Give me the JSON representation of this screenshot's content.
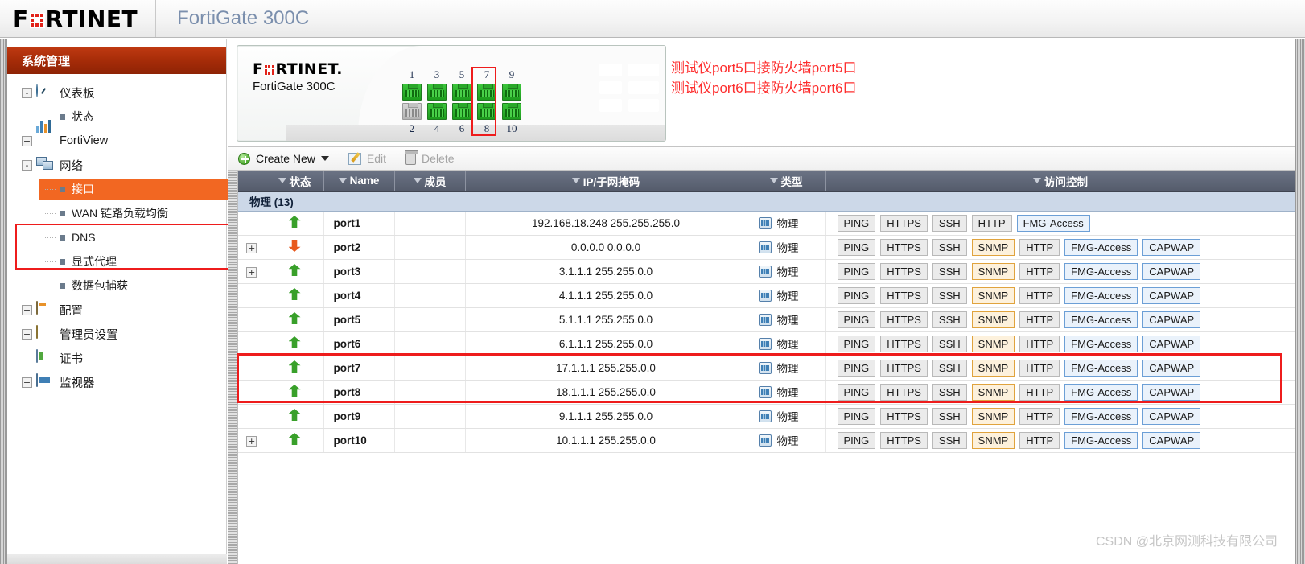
{
  "banner": {
    "logo_text_left": "F",
    "logo_text_right": "RTINET",
    "device_title": "FortiGate 300C"
  },
  "sidebar": {
    "header": "系统管理",
    "items": [
      {
        "label": "仪表板",
        "icon": "dashboard-icon",
        "toggle": "-",
        "level": 1
      },
      {
        "label": "状态",
        "icon": "bullet-icon",
        "toggle": "",
        "level": 2
      },
      {
        "label": "FortiView",
        "icon": "fortiview-icon",
        "toggle": "+",
        "level": 1
      },
      {
        "label": "网络",
        "icon": "network-icon",
        "toggle": "-",
        "level": 1
      },
      {
        "label": "接口",
        "icon": "bullet-icon",
        "toggle": "",
        "level": 2,
        "active": true
      },
      {
        "label": "WAN 链路负载均衡",
        "icon": "bullet-icon",
        "toggle": "",
        "level": 2
      },
      {
        "label": "DNS",
        "icon": "bullet-icon",
        "toggle": "",
        "level": 2
      },
      {
        "label": "显式代理",
        "icon": "bullet-icon",
        "toggle": "",
        "level": 2
      },
      {
        "label": "数据包捕获",
        "icon": "bullet-icon",
        "toggle": "",
        "level": 2
      },
      {
        "label": "配置",
        "icon": "config-icon",
        "toggle": "+",
        "level": 1
      },
      {
        "label": "管理员设置",
        "icon": "admin-icon",
        "toggle": "+",
        "level": 1
      },
      {
        "label": "证书",
        "icon": "certificate-icon",
        "toggle": "",
        "level": 1
      },
      {
        "label": "监视器",
        "icon": "monitor-icon",
        "toggle": "+",
        "level": 1
      }
    ]
  },
  "device_panel": {
    "brand_left": "F",
    "brand_right": "RTINET.",
    "model": "FortiGate 300C",
    "top_port_numbers": [
      "1",
      "3",
      "5",
      "7",
      "9"
    ],
    "bottom_port_numbers": [
      "2",
      "4",
      "6",
      "8",
      "10"
    ],
    "top_ports_up": [
      true,
      true,
      true,
      true,
      true
    ],
    "bottom_ports_up": [
      false,
      true,
      true,
      true,
      true
    ],
    "highlight_note": "ports 5 and 6 outlined in red"
  },
  "annotation": {
    "line1": "测试仪port5口接防火墙port5口",
    "line2": "测试仪port6口接防火墙port6口",
    "color": "#fd2d2d"
  },
  "toolbar": {
    "create_new": "Create New",
    "edit": "Edit",
    "delete": "Delete"
  },
  "table": {
    "headers": [
      "状态",
      "Name",
      "成员",
      "IP/子网掩码",
      "类型",
      "访问控制"
    ],
    "group_label": "物理 (13)",
    "type_label": "物理",
    "rows": [
      {
        "expand": false,
        "state": "up",
        "name": "port1",
        "member": "",
        "ip": "192.168.18.248 255.255.255.0",
        "type": "物理",
        "acl": [
          "PING",
          "HTTPS",
          "SSH",
          "HTTP",
          "FMG-Access"
        ]
      },
      {
        "expand": true,
        "state": "down",
        "name": "port2",
        "member": "",
        "ip": "0.0.0.0 0.0.0.0",
        "type": "物理",
        "acl": [
          "PING",
          "HTTPS",
          "SSH",
          "SNMP",
          "HTTP",
          "FMG-Access",
          "CAPWAP"
        ]
      },
      {
        "expand": true,
        "state": "up",
        "name": "port3",
        "member": "",
        "ip": "3.1.1.1 255.255.0.0",
        "type": "物理",
        "acl": [
          "PING",
          "HTTPS",
          "SSH",
          "SNMP",
          "HTTP",
          "FMG-Access",
          "CAPWAP"
        ]
      },
      {
        "expand": false,
        "state": "up",
        "name": "port4",
        "member": "",
        "ip": "4.1.1.1 255.255.0.0",
        "type": "物理",
        "acl": [
          "PING",
          "HTTPS",
          "SSH",
          "SNMP",
          "HTTP",
          "FMG-Access",
          "CAPWAP"
        ]
      },
      {
        "expand": false,
        "state": "up",
        "name": "port5",
        "member": "",
        "ip": "5.1.1.1 255.255.0.0",
        "type": "物理",
        "acl": [
          "PING",
          "HTTPS",
          "SSH",
          "SNMP",
          "HTTP",
          "FMG-Access",
          "CAPWAP"
        ]
      },
      {
        "expand": false,
        "state": "up",
        "name": "port6",
        "member": "",
        "ip": "6.1.1.1 255.255.0.0",
        "type": "物理",
        "acl": [
          "PING",
          "HTTPS",
          "SSH",
          "SNMP",
          "HTTP",
          "FMG-Access",
          "CAPWAP"
        ]
      },
      {
        "expand": false,
        "state": "up",
        "name": "port7",
        "member": "",
        "ip": "17.1.1.1 255.255.0.0",
        "type": "物理",
        "acl": [
          "PING",
          "HTTPS",
          "SSH",
          "SNMP",
          "HTTP",
          "FMG-Access",
          "CAPWAP"
        ]
      },
      {
        "expand": false,
        "state": "up",
        "name": "port8",
        "member": "",
        "ip": "18.1.1.1 255.255.0.0",
        "type": "物理",
        "acl": [
          "PING",
          "HTTPS",
          "SSH",
          "SNMP",
          "HTTP",
          "FMG-Access",
          "CAPWAP"
        ]
      },
      {
        "expand": false,
        "state": "up",
        "name": "port9",
        "member": "",
        "ip": "9.1.1.1 255.255.0.0",
        "type": "物理",
        "acl": [
          "PING",
          "HTTPS",
          "SSH",
          "SNMP",
          "HTTP",
          "FMG-Access",
          "CAPWAP"
        ]
      },
      {
        "expand": true,
        "state": "up",
        "name": "port10",
        "member": "",
        "ip": "10.1.1.1 255.255.0.0",
        "type": "物理",
        "acl": [
          "PING",
          "HTTPS",
          "SSH",
          "SNMP",
          "HTTP",
          "FMG-Access",
          "CAPWAP"
        ]
      }
    ]
  },
  "watermark": "CSDN @北京网测科技有限公司",
  "colors": {
    "sidebar_header": "#a62c08",
    "active_item": "#f26722",
    "annotation_red": "#fd2d2d",
    "table_header": "#545b6b",
    "group_row": "#ccd8e8",
    "status_up": "#39a02a",
    "status_down": "#e8591d",
    "badge_snmp": "#e0a33d",
    "badge_blue": "#6c9fd6"
  }
}
